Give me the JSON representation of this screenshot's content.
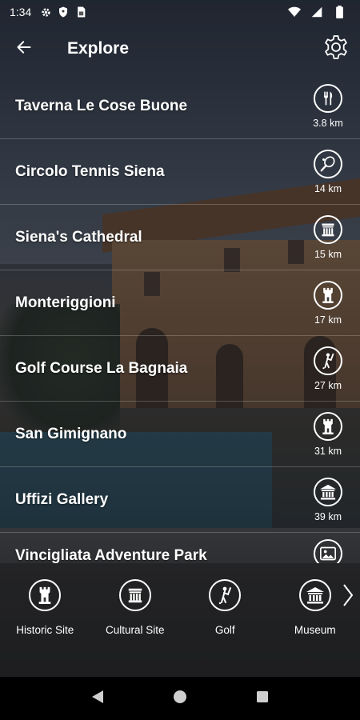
{
  "status_bar": {
    "time": "1:34",
    "left_icons": [
      "gear-icon",
      "shield-icon",
      "sim-card-icon"
    ],
    "right_icons": [
      "wifi-icon",
      "signal-icon",
      "battery-icon"
    ]
  },
  "app_bar": {
    "title": "Explore",
    "back_icon": "arrow-left-icon",
    "settings_icon": "gear-icon"
  },
  "places": [
    {
      "name": "Taverna Le Cose Buone",
      "distance": "3.8 km",
      "icon": "fork-knife-icon"
    },
    {
      "name": "Circolo Tennis Siena",
      "distance": "14 km",
      "icon": "tennis-racket-icon"
    },
    {
      "name": "Siena's Cathedral",
      "distance": "15 km",
      "icon": "temple-icon"
    },
    {
      "name": "Monteriggioni",
      "distance": "17 km",
      "icon": "castle-tower-icon"
    },
    {
      "name": "Golf Course La Bagnaia",
      "distance": "27 km",
      "icon": "golfer-icon"
    },
    {
      "name": "San Gimignano",
      "distance": "31 km",
      "icon": "castle-tower-icon"
    },
    {
      "name": "Uffizi Gallery",
      "distance": "39 km",
      "icon": "museum-icon"
    },
    {
      "name": "Vincigliata Adventure Park",
      "distance": "",
      "icon": "landscape-icon"
    }
  ],
  "categories": [
    {
      "label": "Historic Site",
      "icon": "castle-tower-icon"
    },
    {
      "label": "Cultural Site",
      "icon": "temple-icon"
    },
    {
      "label": "Golf",
      "icon": "golfer-icon"
    },
    {
      "label": "Museum",
      "icon": "museum-icon"
    }
  ],
  "nav_bar": {
    "icons": [
      "back-triangle-icon",
      "home-circle-icon",
      "recents-square-icon"
    ]
  }
}
